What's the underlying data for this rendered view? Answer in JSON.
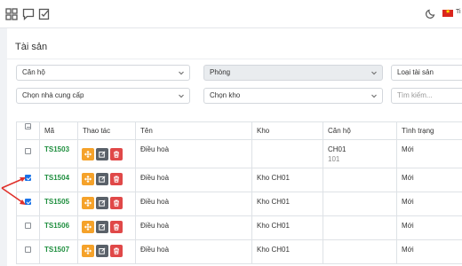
{
  "topbar": {
    "icons": [
      "grid-icon",
      "chat-icon",
      "checklist-icon"
    ],
    "theme_icon": "moon-icon",
    "language": "Ti",
    "flag_color": "#da251d"
  },
  "page": {
    "title": "Tài sản"
  },
  "filters": {
    "can_ho": "Căn hộ",
    "phong": "Phòng",
    "loai_tai_san": "Loại tài sản",
    "nha_cung_cap": "Chọn nhà cung cấp",
    "kho": "Chọn kho",
    "search_placeholder": "Tìm kiếm..."
  },
  "table": {
    "headers": [
      "Mã",
      "Thao tác",
      "Tên",
      "Kho",
      "Căn hộ",
      "Tình trạng"
    ],
    "rows": [
      {
        "code": "TS1503",
        "name": "Điều hoà",
        "kho": "",
        "can_ho": "CH01",
        "can_ho_sub": "101",
        "status": "Mới",
        "checked": false
      },
      {
        "code": "TS1504",
        "name": "Điều hoà",
        "kho": "Kho CH01",
        "can_ho": "",
        "can_ho_sub": "",
        "status": "Mới",
        "checked": true
      },
      {
        "code": "TS1505",
        "name": "Điều hoà",
        "kho": "Kho CH01",
        "can_ho": "",
        "can_ho_sub": "",
        "status": "Mới",
        "checked": true
      },
      {
        "code": "TS1506",
        "name": "Điều hoà",
        "kho": "Kho CH01",
        "can_ho": "",
        "can_ho_sub": "",
        "status": "Mới",
        "checked": false
      },
      {
        "code": "TS1507",
        "name": "Điều hoà",
        "kho": "Kho CH01",
        "can_ho": "",
        "can_ho_sub": "",
        "status": "Mới",
        "checked": false
      }
    ]
  },
  "colors": {
    "move_button": "#f5a22a",
    "edit_button": "#5a6169",
    "delete_button": "#e04848",
    "code_text": "#1e8e3e",
    "arrow": "#e0312b"
  }
}
